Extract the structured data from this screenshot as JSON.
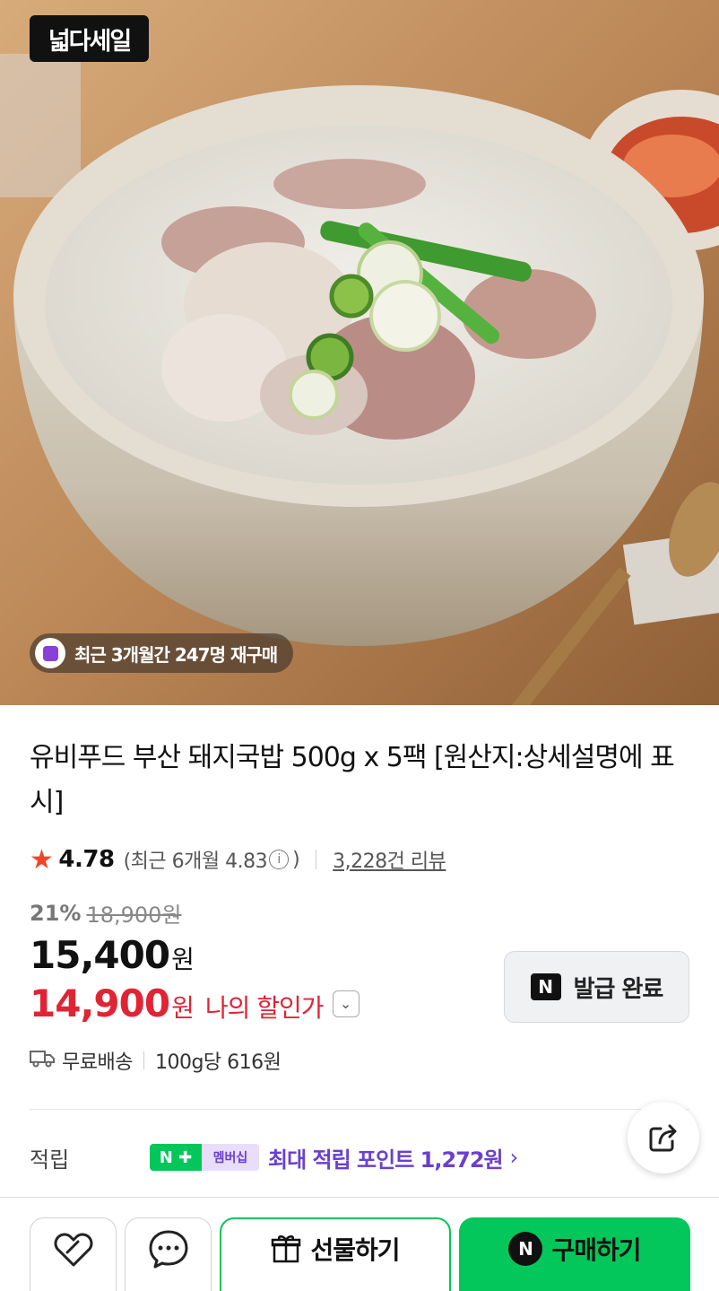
{
  "hero": {
    "badge": "넓다세일",
    "repurchase_text": "최근 3개월간 247명 재구매"
  },
  "product": {
    "title": "유비푸드 부산 돼지국밥 500g x 5팩 [원산지:상세설명에 표시]",
    "rating": "4.78",
    "recent_rating": "(최근 6개월 4.83",
    "recent_rating_close": ")",
    "info_icon": "ⓘ",
    "review_count": "3,228건 리뷰",
    "discount_percent": "21%",
    "original_price": "18,900원",
    "price": "15,400",
    "price_unit": "원",
    "my_price": "14,900",
    "my_price_unit": "원",
    "my_price_label": "나의 할인가",
    "coupon_logo": "N",
    "coupon_label": "발급 완료",
    "shipping": "무료배송",
    "unit_price": "100g당 616원"
  },
  "points": {
    "label": "적립",
    "badge_left": "N ✚",
    "badge_right": "멤버십",
    "text": "최대 적립 포인트 1,272원"
  },
  "actions": {
    "gift_label": "선물하기",
    "buy_logo": "N",
    "buy_label": "구매하기"
  },
  "colors": {
    "naver_green": "#03c75a",
    "sale_red": "#e02435",
    "membership_purple": "#6a3fd0",
    "star": "#f0452a"
  },
  "icons": [
    "sale-badge-logo",
    "repurchase-icon",
    "star-icon",
    "info-icon",
    "chevron-down-icon",
    "truck-icon",
    "share-icon",
    "chevron-right-icon",
    "heart-icon",
    "chat-icon",
    "gift-icon"
  ]
}
